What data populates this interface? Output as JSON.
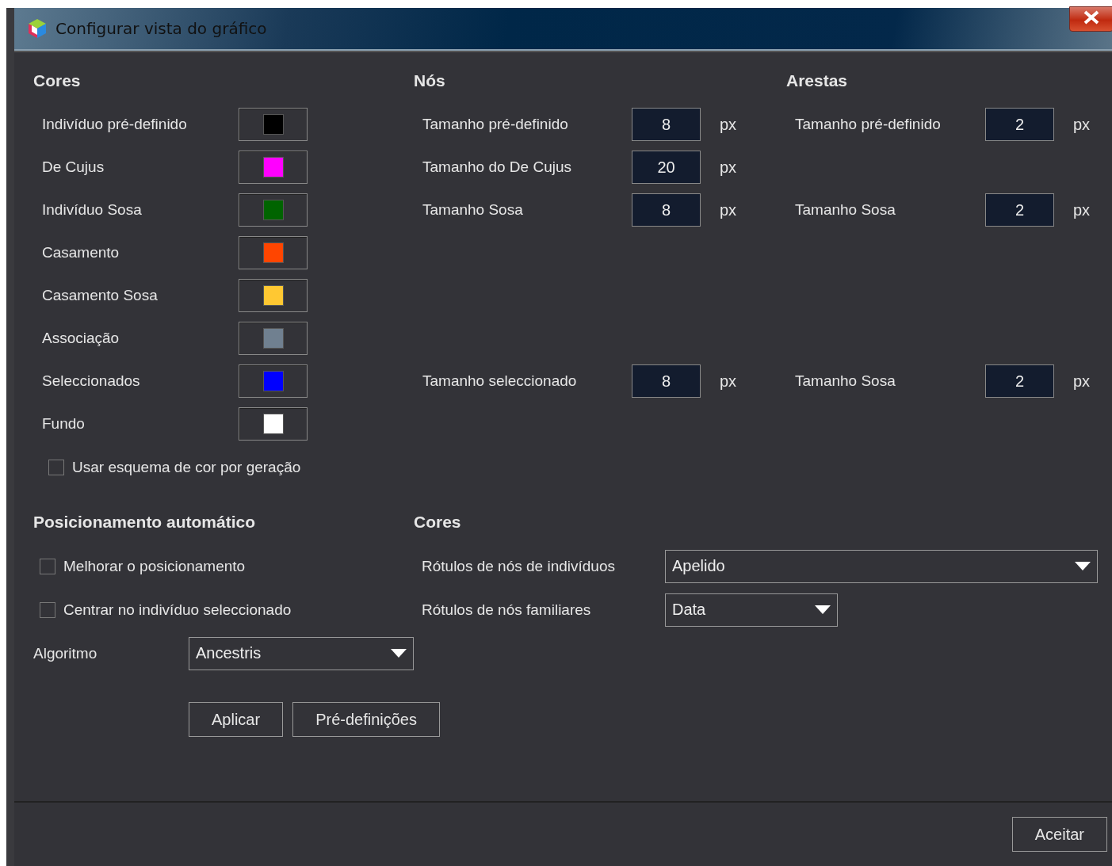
{
  "window": {
    "title": "Configurar vista do gráfico"
  },
  "sections": {
    "colors_heading": "Cores",
    "nodes_heading": "Nós",
    "edges_heading": "Arestas"
  },
  "rows": [
    {
      "color": {
        "label": "Indivíduo pré-definido",
        "color": "#000000"
      },
      "node": {
        "label": "Tamanho pré-definido",
        "value": "8",
        "unit": "px"
      },
      "edge": {
        "label": "Tamanho pré-definido",
        "value": "2",
        "unit": "px"
      }
    },
    {
      "color": {
        "label": "De Cujus",
        "color": "#ff00ff"
      },
      "node": {
        "label": "Tamanho do De Cujus",
        "value": "20",
        "unit": "px"
      }
    },
    {
      "color": {
        "label": "Indivíduo Sosa",
        "color": "#006400"
      },
      "node": {
        "label": "Tamanho Sosa",
        "value": "8",
        "unit": "px"
      },
      "edge": {
        "label": "Tamanho Sosa",
        "value": "2",
        "unit": "px"
      }
    },
    {
      "color": {
        "label": "Casamento",
        "color": "#ff4500"
      }
    },
    {
      "color": {
        "label": "Casamento Sosa",
        "color": "#ffc832"
      }
    },
    {
      "color": {
        "label": "Associação",
        "color": "#708090"
      }
    },
    {
      "color": {
        "label": "Seleccionados",
        "color": "#0000ff"
      },
      "node": {
        "label": "Tamanho seleccionado",
        "value": "8",
        "unit": "px"
      },
      "edge": {
        "label": "Tamanho Sosa",
        "value": "2",
        "unit": "px"
      }
    },
    {
      "color": {
        "label": "Fundo",
        "color": "#ffffff"
      }
    }
  ],
  "generation_scheme": {
    "label": "Usar esquema de cor por geração",
    "checked": false
  },
  "auto_layout": {
    "heading": "Posicionamento automático",
    "options": [
      {
        "label": "Melhorar o posicionamento",
        "checked": false
      },
      {
        "label": "Centrar no indivíduo seleccionado",
        "checked": false
      }
    ],
    "algorithm": {
      "label": "Algoritmo",
      "value": "Ancestris"
    },
    "buttons": [
      "Aplicar",
      "Pré-definições"
    ]
  },
  "labels": {
    "heading": "Cores",
    "fields": [
      {
        "label": "Rótulos de nós de indivíduos",
        "value": "Apelido",
        "wide": true
      },
      {
        "label": "Rótulos de nós familiares",
        "value": "Data",
        "wide": false
      }
    ]
  },
  "footer": {
    "button": "Aceitar"
  }
}
